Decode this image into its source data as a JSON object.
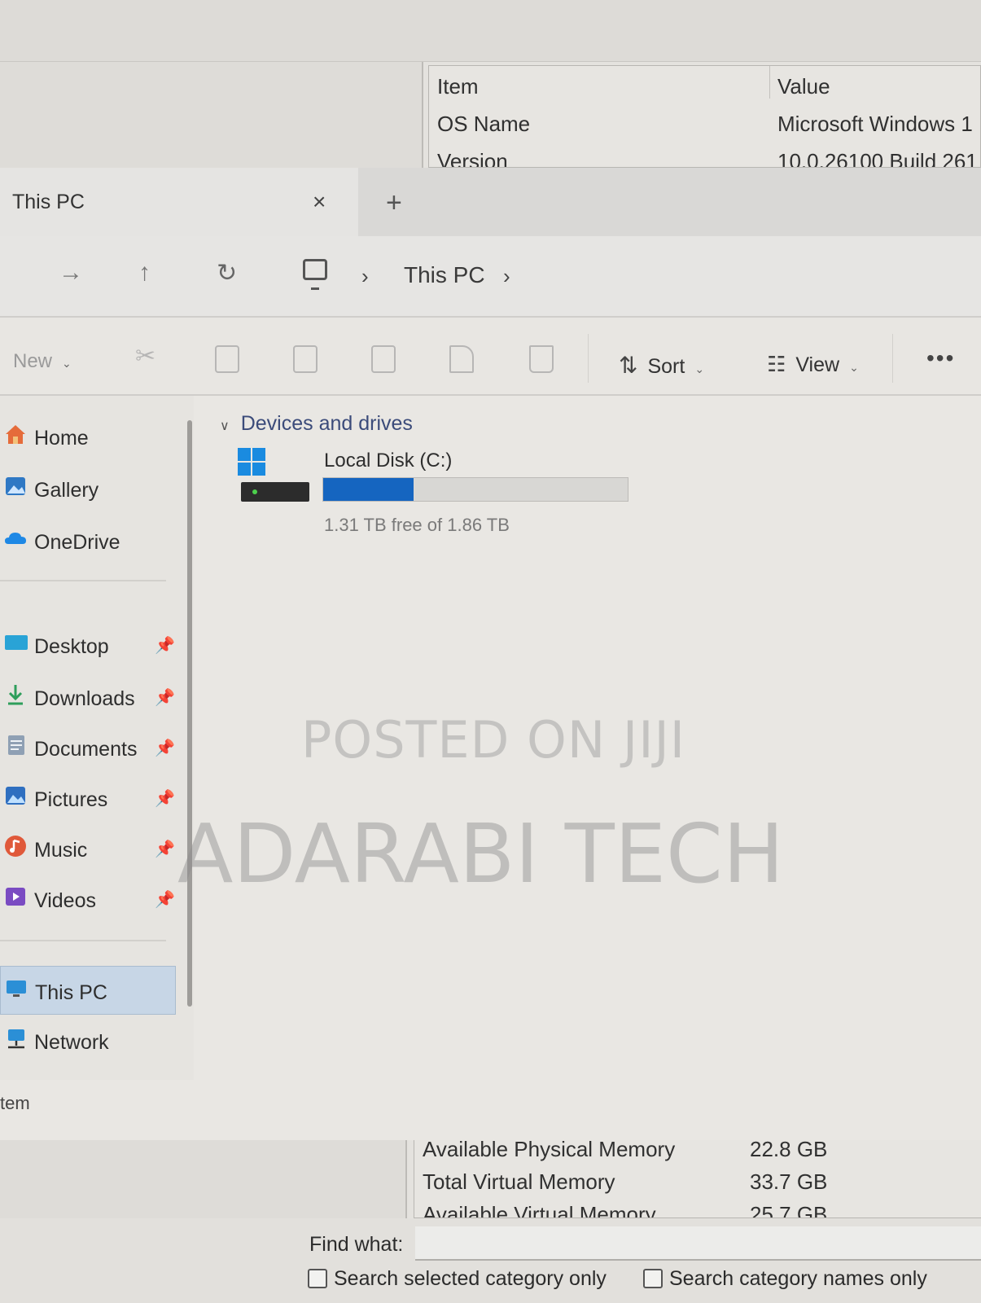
{
  "sysinfo": {
    "top_grid": {
      "rows": [
        {
          "item": "Item",
          "value": "Value"
        },
        {
          "item": "OS Name",
          "value": "Microsoft Windows 1"
        },
        {
          "item": "Version",
          "value": "10.0.26100 Build 261"
        }
      ]
    },
    "bottom_grid": {
      "rows": [
        {
          "item": "Available Physical Memory",
          "value": "22.8 GB"
        },
        {
          "item": "Total Virtual Memory",
          "value": "33.7 GB"
        },
        {
          "item": "Available Virtual Memory",
          "value": "25.7 GB"
        }
      ]
    },
    "find": {
      "label": "Find what:",
      "value": "",
      "check1": "Search selected category only",
      "check2": "Search category names only"
    }
  },
  "explorer": {
    "tab": {
      "title": "This PC",
      "close": "×",
      "new_tab": "+"
    },
    "nav": {
      "back": "←",
      "forward": "→",
      "up": "↑",
      "refresh": "↻",
      "sep": "›"
    },
    "breadcrumb": {
      "location": "This PC"
    },
    "toolbar": {
      "new_label": "New",
      "sort_label": "Sort",
      "view_label": "View",
      "more": "•••",
      "icons": [
        "cut-icon",
        "copy-icon",
        "paste-icon",
        "rename-icon",
        "share-icon",
        "delete-icon"
      ]
    },
    "sidebar": {
      "items": [
        {
          "label": "Home",
          "icon": "home-icon",
          "pinned": false
        },
        {
          "label": "Gallery",
          "icon": "gallery-icon",
          "pinned": false
        },
        {
          "label": "OneDrive",
          "icon": "cloud-icon",
          "pinned": false
        },
        {
          "label": "Desktop",
          "icon": "desktop-folder-icon",
          "pinned": true
        },
        {
          "label": "Downloads",
          "icon": "download-icon",
          "pinned": true
        },
        {
          "label": "Documents",
          "icon": "documents-icon",
          "pinned": true
        },
        {
          "label": "Pictures",
          "icon": "pictures-icon",
          "pinned": true
        },
        {
          "label": "Music",
          "icon": "music-icon",
          "pinned": true
        },
        {
          "label": "Videos",
          "icon": "videos-icon",
          "pinned": true
        },
        {
          "label": "This PC",
          "icon": "computer-icon",
          "selected": true
        },
        {
          "label": "Network",
          "icon": "network-icon"
        }
      ],
      "pin_glyph": "📌"
    },
    "status": "tem",
    "content": {
      "group": "Devices and drives",
      "drive": {
        "name": "Local Disk (C:)",
        "free_text": "1.31 TB free of 1.86 TB",
        "used_fraction": 0.296,
        "bar_color": "#1565c0"
      }
    }
  },
  "watermarks": {
    "line1": "POSTED ON JIJI",
    "line2": "ADARABI TECH"
  }
}
